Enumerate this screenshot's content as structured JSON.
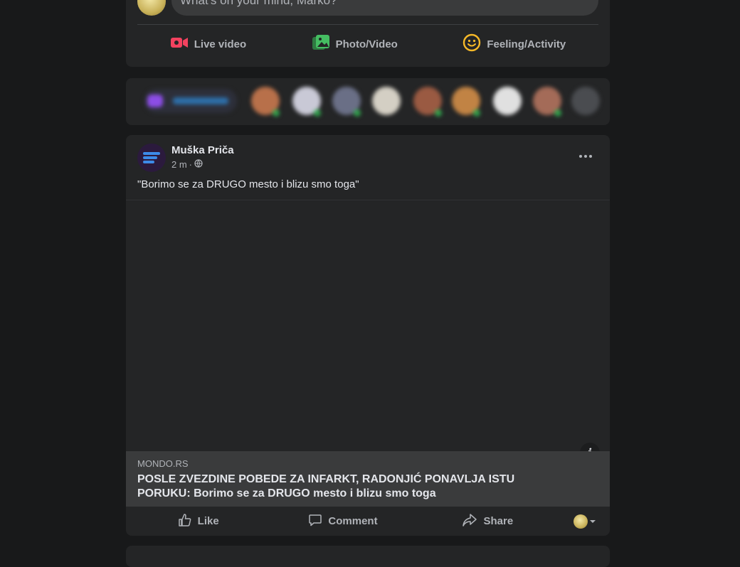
{
  "composer": {
    "placeholder": "What's on your mind, Marko?",
    "actions": [
      {
        "label": "Live video",
        "icon": "live-video-icon",
        "color": "#f3425f"
      },
      {
        "label": "Photo/Video",
        "icon": "photo-icon",
        "color": "#45bd62"
      },
      {
        "label": "Feeling/Activity",
        "icon": "smiley-icon",
        "color": "#f7b928"
      }
    ]
  },
  "post": {
    "page_name": "Muška Priča",
    "time": "2 m",
    "separator": "·",
    "caption": "\"Borimo se za DRUGO mesto i blizu smo toga\"",
    "link": {
      "domain": "MONDO.RS",
      "title": "POSLE ZVEZDINE POBEDE ZA INFARKT, RADONJIĆ PONAVLJA ISTU PORUKU: Borimo se za DRUGO mesto i blizu smo toga"
    },
    "buttons": {
      "like": "Like",
      "comment": "Comment",
      "share": "Share"
    }
  },
  "colors": {
    "background": "#18191a",
    "card": "#242526",
    "text": "#e4e6eb",
    "muted": "#b0b3b8"
  }
}
